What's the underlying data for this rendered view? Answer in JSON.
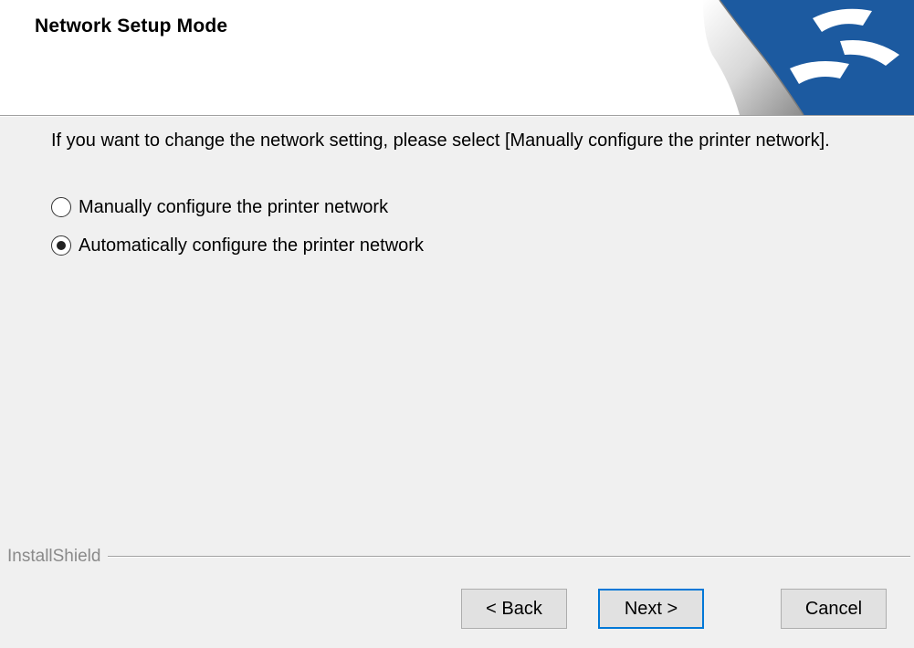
{
  "header": {
    "title": "Network Setup Mode",
    "logo_icon": "installer-banner-logo-icon"
  },
  "content": {
    "instruction": "If you want to change the network setting, please select [Manually configure the printer network].",
    "options": [
      {
        "label": "Manually configure the printer network",
        "checked": false
      },
      {
        "label": "Automatically configure the printer network",
        "checked": true
      }
    ]
  },
  "footer": {
    "brand": "InstallShield",
    "back_label": "< Back",
    "next_label": "Next >",
    "cancel_label": "Cancel"
  },
  "colors": {
    "background": "#f0f0f0",
    "header_background": "#ffffff",
    "logo_blue": "#1c5aa0",
    "default_button_border": "#0078d7"
  }
}
